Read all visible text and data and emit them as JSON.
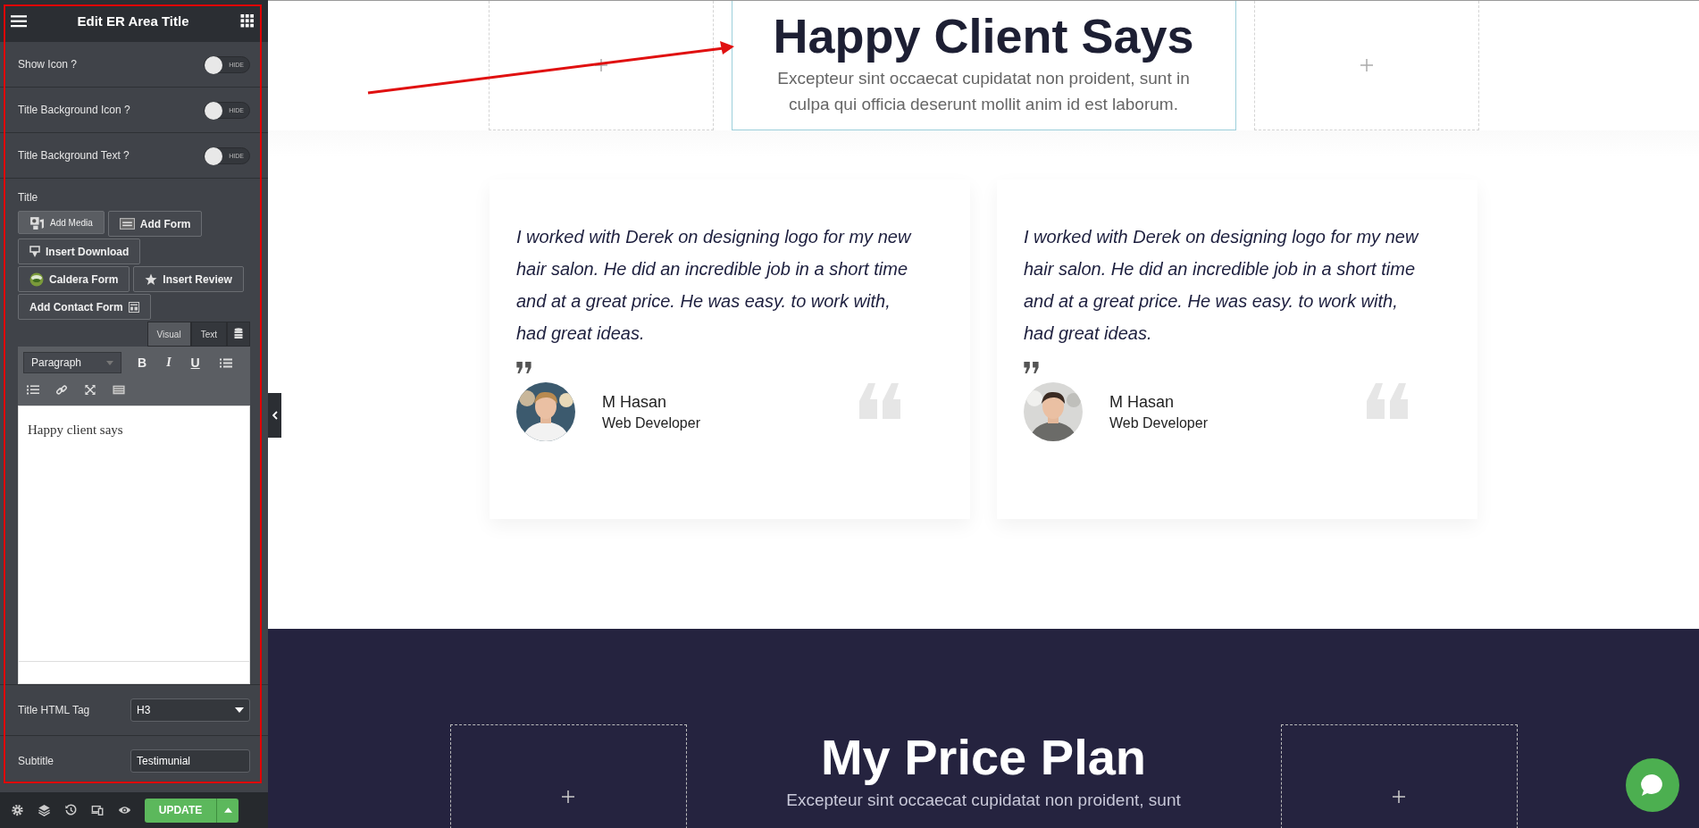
{
  "panel": {
    "title": "Edit ER Area Title",
    "toggles": [
      {
        "label": "Show Icon ?",
        "on": false,
        "state_text": "HIDE"
      },
      {
        "label": "Title Background Icon ?",
        "on": false,
        "state_text": "HIDE"
      },
      {
        "label": "Title Background Text ?",
        "on": false,
        "state_text": "HIDE"
      }
    ],
    "title_label": "Title",
    "media_buttons": [
      {
        "label": "Add Media",
        "kind": "media"
      },
      {
        "label": "Add Form",
        "kind": "form"
      },
      {
        "label": "Insert Download",
        "kind": "download"
      },
      {
        "label": "Caldera Form",
        "kind": "caldera"
      },
      {
        "label": "Insert Review",
        "kind": "review"
      },
      {
        "label": "Add Contact Form",
        "kind": "contact"
      }
    ],
    "editor_tabs": [
      {
        "label": "Visual",
        "selected": true
      },
      {
        "label": "Text",
        "selected": false
      }
    ],
    "format_select": "Paragraph",
    "format_buttons": [
      "B",
      "I",
      "U"
    ],
    "editor_content": "Happy client says",
    "fields": [
      {
        "label": "Title HTML Tag",
        "kind": "select",
        "value": "H3"
      },
      {
        "label": "Subtitle",
        "kind": "text",
        "value": "Testimunial"
      }
    ],
    "update_button": "UPDATE"
  },
  "heading_section": {
    "title": "Happy Client Says",
    "subtitle": "Excepteur sint occaecat cupidatat non proident, sunt in culpa qui officia deserunt mollit anim id est laborum."
  },
  "testimonials": [
    {
      "quote": "I worked with Derek on designing logo for my new hair salon. He did an incredible job in a short time and at a great price. He was easy. to work with, had great ideas.",
      "name": "M Hasan",
      "role": "Web Developer"
    },
    {
      "quote": "I worked with Derek on designing logo for my new hair salon. He did an incredible job in a short time and at a great price. He was easy. to work with, had great ideas.",
      "name": "M Hasan",
      "role": "Web Developer"
    }
  ],
  "price_section": {
    "title": "My Price Plan",
    "subtitle": "Excepteur sint occaecat cupidatat non proident, sunt"
  }
}
